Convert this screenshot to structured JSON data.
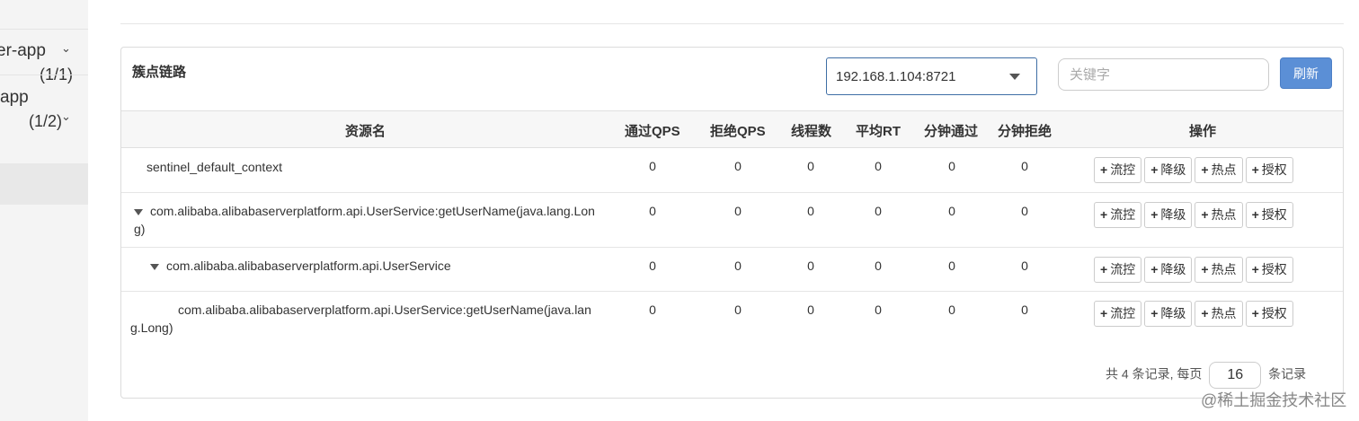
{
  "sidebar": {
    "app1_name": "er-app",
    "app1_count": "(1/1)",
    "app2_name": "app",
    "app2_count": "(1/2)"
  },
  "panel": {
    "title": "簇点链路",
    "machine_select": "192.168.1.104:8721",
    "search_placeholder": "关键字",
    "refresh_label": "刷新"
  },
  "table": {
    "headers": {
      "name": "资源名",
      "pass_qps": "通过QPS",
      "block_qps": "拒绝QPS",
      "threads": "线程数",
      "avg_rt": "平均RT",
      "minute_pass": "分钟通过",
      "minute_block": "分钟拒绝",
      "ops": "操作"
    },
    "rows": [
      {
        "name": "sentinel_default_context",
        "pass_qps": "0",
        "block_qps": "0",
        "threads": "0",
        "avg_rt": "0",
        "minute_pass": "0",
        "minute_block": "0"
      },
      {
        "name": "com.alibaba.alibabaserverplatform.api.UserService:getUserName(java.lang.Lon",
        "name_cont": "g)",
        "pass_qps": "0",
        "block_qps": "0",
        "threads": "0",
        "avg_rt": "0",
        "minute_pass": "0",
        "minute_block": "0"
      },
      {
        "name": "com.alibaba.alibabaserverplatform.api.UserService",
        "pass_qps": "0",
        "block_qps": "0",
        "threads": "0",
        "avg_rt": "0",
        "minute_pass": "0",
        "minute_block": "0"
      },
      {
        "name": "com.alibaba.alibabaserverplatform.api.UserService:getUserName(java.lan",
        "name_cont": "g.Long)",
        "pass_qps": "0",
        "block_qps": "0",
        "threads": "0",
        "avg_rt": "0",
        "minute_pass": "0",
        "minute_block": "0"
      }
    ],
    "actions": {
      "flow": "流控",
      "degrade": "降级",
      "hot": "热点",
      "auth": "授权"
    }
  },
  "pager": {
    "total_text": "共 4 条记录, 每页",
    "page_size": "16",
    "suffix": "条记录"
  },
  "watermark": "@稀土掘金技术社区"
}
